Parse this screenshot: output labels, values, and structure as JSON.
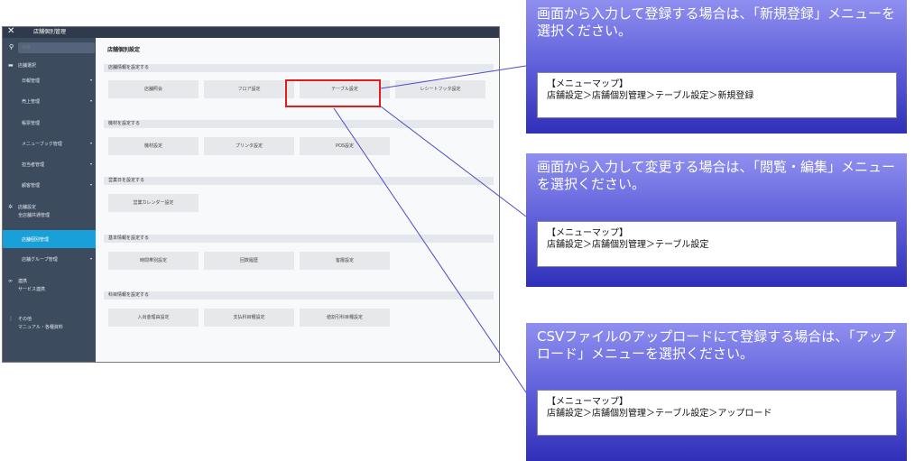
{
  "window": {
    "title": "店舗個別管理",
    "close_glyph": "✕"
  },
  "search": {
    "placeholder": "検索"
  },
  "sidebar": {
    "items": [
      {
        "icon": "store-icon",
        "label": "店舗選択"
      },
      {
        "label": "日報管理"
      },
      {
        "label": "売上管理"
      },
      {
        "label": "帳票管理"
      },
      {
        "label": "メニューブック管理"
      },
      {
        "label": "担当者管理"
      },
      {
        "label": "顧客管理"
      },
      {
        "icon": "gear-icon",
        "label": "店舗設定",
        "sub": "全店舗共通管理"
      },
      {
        "label": "店舗個別管理"
      },
      {
        "label": "店舗グループ管理"
      },
      {
        "icon": "link-icon",
        "label": "連携",
        "sub": "サービス連携"
      },
      {
        "icon": "more-icon",
        "label": "その他",
        "sub": "マニュアル・各種資料"
      }
    ]
  },
  "main": {
    "page_title": "店舗個別設定",
    "sections": [
      {
        "heading": "店舗情報を設定する",
        "buttons": [
          "店舗照会",
          "フロア設定",
          "テーブル設定",
          "レシートフッタ設定"
        ]
      },
      {
        "heading": "機材を設定する",
        "buttons": [
          "機材設定",
          "プリンタ設定",
          "POS設定"
        ]
      },
      {
        "heading": "営業日を設定する",
        "buttons": [
          "営業カレンダー設定"
        ]
      },
      {
        "heading": "基本情報を設定する",
        "buttons": [
          "時間帯別設定",
          "回数履歴",
          "客層設定"
        ]
      },
      {
        "heading": "科目情報を設定する",
        "buttons": [
          "入出金理由設定",
          "支払科目種設定",
          "値割引科目種設定"
        ]
      }
    ]
  },
  "callouts": [
    {
      "text": "画面から入力して登録する場合は、「新規登録」メニューを選択ください。",
      "map_title": "【メニューマップ】",
      "map_path": "店舗設定＞店舗個別管理＞テーブル設定＞新規登録"
    },
    {
      "text": "画面から入力して変更する場合は、「閲覧・編集」メニューを選択ください。",
      "map_title": "【メニューマップ】",
      "map_path": "店舗設定＞店舗個別管理＞テーブル設定"
    },
    {
      "text": "CSVファイルのアップロードにて登録する場合は、「アップロード」メニューを選択ください。",
      "map_title": "【メニューマップ】",
      "map_path": "店舗設定＞店舗個別管理＞テーブル設定＞アップロード"
    }
  ],
  "colors": {
    "sidebar": "#3d4b5e",
    "active": "#1aa0d8",
    "highlight": "#e01c1c",
    "callout": "#5a5ad8"
  }
}
